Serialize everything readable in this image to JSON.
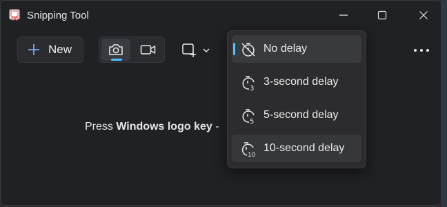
{
  "app": {
    "title": "Snipping Tool"
  },
  "toolbar": {
    "new_label": "New",
    "snip_mode_selected": "photo",
    "more_icon": "more-horizontal-icon"
  },
  "canvas": {
    "instruction_prefix": "Press ",
    "instruction_bold": "Windows logo key",
    "instruction_suffix": " -"
  },
  "delay_menu": {
    "items": [
      {
        "label": "No delay",
        "selected": true
      },
      {
        "label": "3-second delay",
        "selected": false
      },
      {
        "label": "5-second delay",
        "selected": false
      },
      {
        "label": "10-second delay",
        "selected": false
      }
    ]
  },
  "colors": {
    "accent": "#4cc2ff",
    "window_bg": "#202124",
    "menu_bg": "#2c2c2e"
  }
}
